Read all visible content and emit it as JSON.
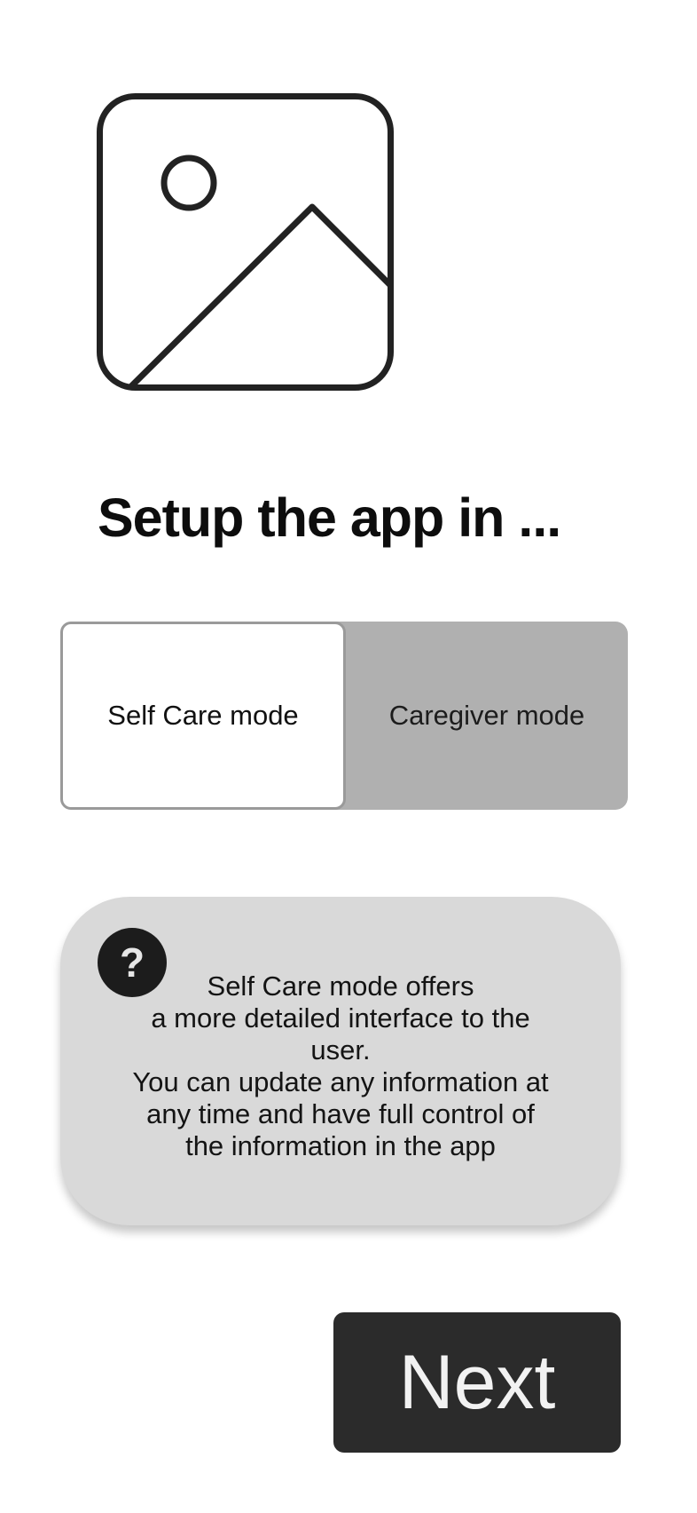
{
  "hero": {
    "icon": "image-placeholder-icon"
  },
  "title": "Setup the app in ...",
  "mode_toggle": {
    "options": [
      {
        "label": "Self Care mode",
        "selected": true
      },
      {
        "label": "Caregiver mode",
        "selected": false
      }
    ]
  },
  "info_card": {
    "icon": "question-mark-icon",
    "icon_glyph": "?",
    "lines": [
      "Self Care mode offers",
      "a more detailed interface to the",
      "user.",
      "You can update any information at",
      "any time and have full control of",
      "the information in the app"
    ]
  },
  "next_button": {
    "label": "Next"
  },
  "colors": {
    "toggle_background": "#b0b0b0",
    "card_background": "#d9d9d9",
    "button_background": "#2b2b2b",
    "icon_dark": "#1c1c1c"
  }
}
